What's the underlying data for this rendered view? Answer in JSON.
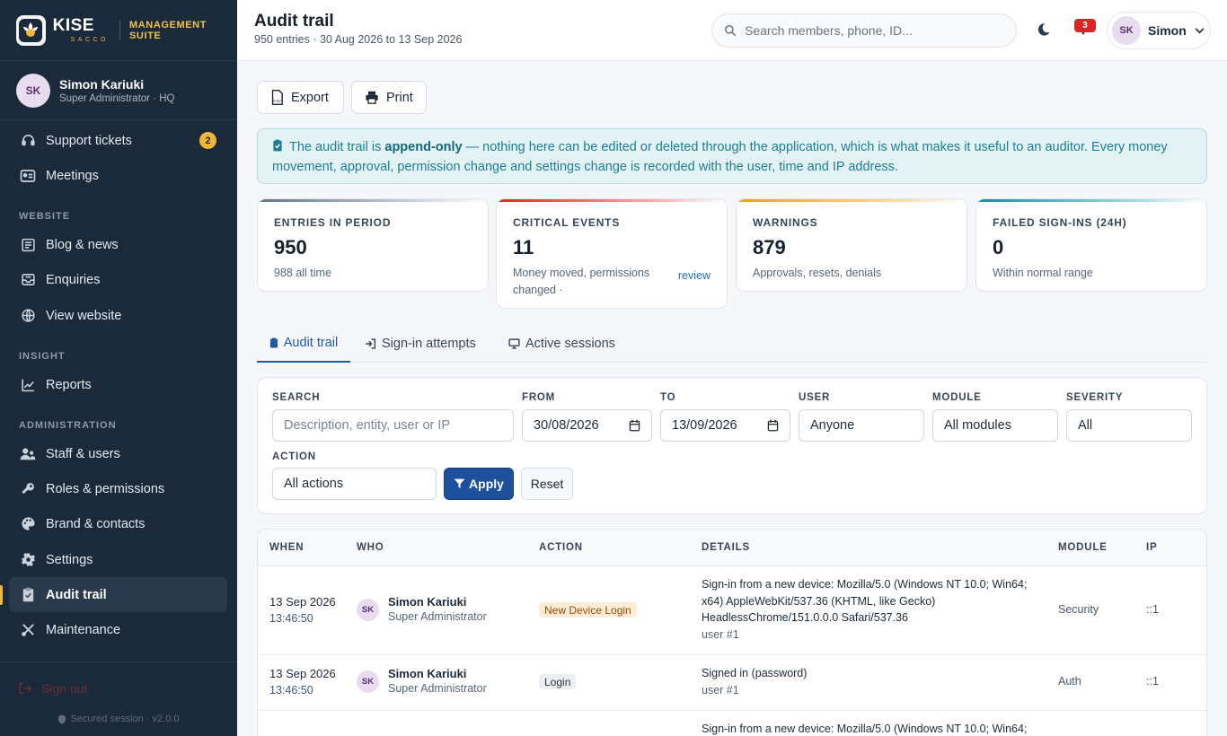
{
  "brand": {
    "name": "KISE",
    "sub": "SACCO",
    "suite": "MANAGEMENT SUITE"
  },
  "profile": {
    "initials": "SK",
    "name": "Simon Kariuki",
    "role": "Super Administrator · HQ"
  },
  "sidebar": {
    "items": [
      {
        "label": "Support tickets",
        "icon": "headset-icon",
        "badge": "2"
      },
      {
        "label": "Meetings",
        "icon": "meetings-icon"
      },
      {
        "label": "Blog & news",
        "icon": "newspaper-icon"
      },
      {
        "label": "Enquiries",
        "icon": "inbox-icon"
      },
      {
        "label": "View website",
        "icon": "globe-icon"
      },
      {
        "label": "Reports",
        "icon": "chart-line-icon"
      },
      {
        "label": "Staff & users",
        "icon": "users-icon"
      },
      {
        "label": "Roles & permissions",
        "icon": "key-icon"
      },
      {
        "label": "Brand & contacts",
        "icon": "palette-icon"
      },
      {
        "label": "Settings",
        "icon": "gear-icon"
      },
      {
        "label": "Audit trail",
        "icon": "clipboard-icon",
        "active": true
      },
      {
        "label": "Maintenance",
        "icon": "tools-icon"
      }
    ],
    "sections": {
      "website": "WEBSITE",
      "insight": "INSIGHT",
      "administration": "ADMINISTRATION"
    },
    "sign_out": "Sign out",
    "secured": "Secured session · v2.0.0"
  },
  "header": {
    "title": "Audit trail",
    "subtitle": "950 entries · 30 Aug 2026 to 13 Sep 2026",
    "search_placeholder": "Search members, phone, ID...",
    "notifications": "3",
    "user_initials": "SK",
    "user_name": "Simon"
  },
  "toolbar": {
    "export": "Export",
    "print": "Print"
  },
  "notice": {
    "pre": "The audit trail is ",
    "bold": "append-only",
    "post": " — nothing here can be edited or deleted through the application, which is what makes it useful to an auditor. Every money movement, approval, permission change and settings change is recorded with the user, time and IP address."
  },
  "stats": [
    {
      "label": "ENTRIES IN PERIOD",
      "value": "950",
      "note": "988 all time",
      "color": "#64748b"
    },
    {
      "label": "CRITICAL EVENTS",
      "value": "11",
      "note": "Money moved, permissions changed ·",
      "link": "review",
      "color": "#dc2626"
    },
    {
      "label": "WARNINGS",
      "value": "879",
      "note": "Approvals, resets, denials",
      "color": "#e5a326"
    },
    {
      "label": "FAILED SIGN-INS (24H)",
      "value": "0",
      "note": "Within normal range",
      "color": "#1e8a9e"
    }
  ],
  "tabs": [
    {
      "label": "Audit trail"
    },
    {
      "label": "Sign-in attempts"
    },
    {
      "label": "Active sessions"
    }
  ],
  "filters": {
    "search_label": "SEARCH",
    "search_placeholder": "Description, entity, user or IP",
    "from_label": "FROM",
    "from_value": "30/08/2026",
    "to_label": "TO",
    "to_value": "13/09/2026",
    "user_label": "USER",
    "user_value": "Anyone",
    "module_label": "MODULE",
    "module_value": "All modules",
    "severity_label": "SEVERITY",
    "severity_value": "All",
    "action_label": "ACTION",
    "action_value": "All actions",
    "apply": "Apply",
    "reset": "Reset"
  },
  "table": {
    "headers": {
      "when": "WHEN",
      "who": "WHO",
      "action": "ACTION",
      "details": "DETAILS",
      "module": "MODULE",
      "ip": "IP"
    },
    "rows": [
      {
        "date": "13 Sep 2026",
        "time": "13:46:50",
        "initials": "SK",
        "name": "Simon Kariuki",
        "role": "Super Administrator",
        "action": "New Device Login",
        "action_type": "warn",
        "details": "Sign-in from a new device: Mozilla/5.0 (Windows NT 10.0; Win64; x64) AppleWebKit/537.36 (KHTML, like Gecko) HeadlessChrome/151.0.0.0 Safari/537.36",
        "entity": "user #1",
        "module": "Security",
        "ip": "::1"
      },
      {
        "date": "13 Sep 2026",
        "time": "13:46:50",
        "initials": "SK",
        "name": "Simon Kariuki",
        "role": "Super Administrator",
        "action": "Login",
        "action_type": "neutral",
        "details": "Signed in (password)",
        "entity": "user #1",
        "module": "Auth",
        "ip": "::1"
      },
      {
        "details": "Sign-in from a new device: Mozilla/5.0 (Windows NT 10.0; Win64;"
      }
    ]
  }
}
